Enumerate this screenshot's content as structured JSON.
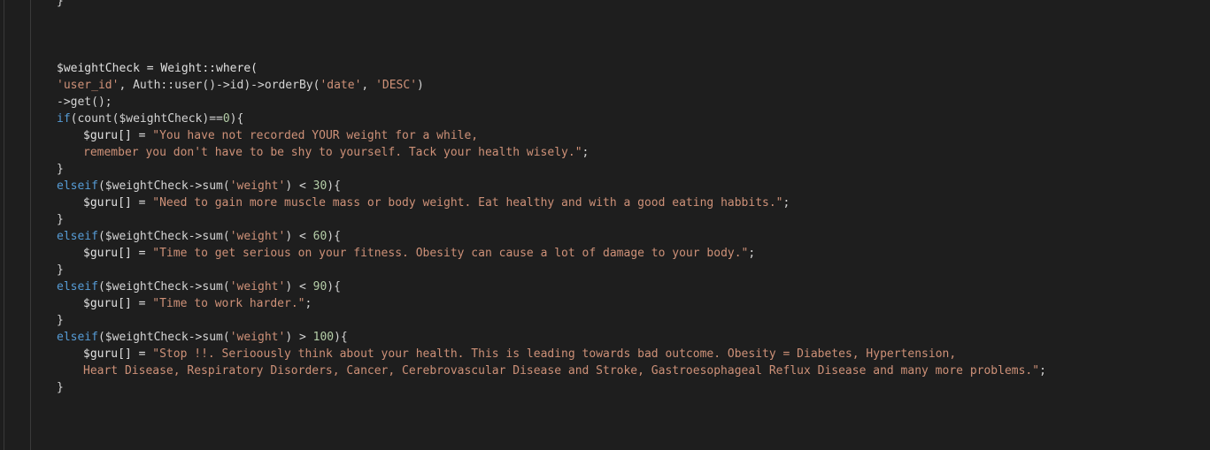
{
  "editor": {
    "colors": {
      "background": "#1e1e1e",
      "text": "#d4d4d4",
      "string": "#ce9178",
      "keyword": "#569cd6",
      "number": "#b5cea8"
    },
    "code": {
      "l0_brace": "}",
      "l4_a": "$weightCheck = Weight::where(",
      "l5_str1": "'user_id'",
      "l5_b": ", Auth::user()->id)->orderBy(",
      "l5_str2": "'date'",
      "l5_c": ", ",
      "l5_str3": "'DESC'",
      "l5_d": ")",
      "l6": "->get();",
      "l7_kw": "if",
      "l7_b": "(count($weightCheck)==",
      "l7_num": "0",
      "l7_c": "){",
      "l8_a": "$guru[] = ",
      "l8_str": "\"You have not recorded YOUR weight for a while,",
      "l9_str": "remember you don't have to be shy to yourself. Tack your health wisely.\"",
      "l9_end": ";",
      "l10_brace": "}",
      "l11_kw": "elseif",
      "l11_b": "($weightCheck->sum(",
      "l11_str": "'weight'",
      "l11_c": ") < ",
      "l11_num": "30",
      "l11_d": "){",
      "l12_a": "$guru[] = ",
      "l12_str": "\"Need to gain more muscle mass or body weight. Eat healthy and with a good eating habbits.\"",
      "l12_end": ";",
      "l13_brace": "}",
      "l14_kw": "elseif",
      "l14_b": "($weightCheck->sum(",
      "l14_str": "'weight'",
      "l14_c": ") < ",
      "l14_num": "60",
      "l14_d": "){",
      "l15_a": "$guru[] = ",
      "l15_str": "\"Time to get serious on your fitness. Obesity can cause a lot of damage to your body.\"",
      "l15_end": ";",
      "l16_brace": "}",
      "l17_kw": "elseif",
      "l17_b": "($weightCheck->sum(",
      "l17_str": "'weight'",
      "l17_c": ") < ",
      "l17_num": "90",
      "l17_d": "){",
      "l18_a": "$guru[] = ",
      "l18_str": "\"Time to work harder.\"",
      "l18_end": ";",
      "l19_brace": "}",
      "l20_kw": "elseif",
      "l20_b": "($weightCheck->sum(",
      "l20_str": "'weight'",
      "l20_c": ") > ",
      "l20_num": "100",
      "l20_d": "){",
      "l21_a": "$guru[] = ",
      "l21_str": "\"Stop !!. Serioously think about your health. This is leading towards bad outcome. Obesity = Diabetes, Hypertension,",
      "l22_str": "Heart Disease, Respiratory Disorders, Cancer, Cerebrovascular Disease and Stroke, Gastroesophageal Reflux Disease and many more problems.\"",
      "l22_end": ";",
      "l23_brace": "}"
    }
  }
}
